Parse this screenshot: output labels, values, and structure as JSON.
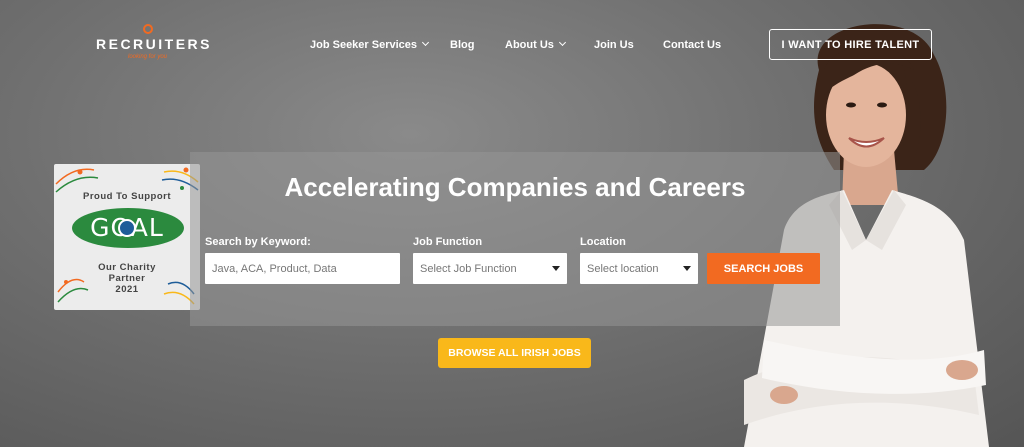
{
  "brand": {
    "name": "RECRUITERS",
    "tagline": "looking for you",
    "accent": "#f26a21"
  },
  "nav": {
    "items": [
      {
        "label": "Job Seeker Services",
        "has_dropdown": true
      },
      {
        "label": "Blog",
        "has_dropdown": false
      },
      {
        "label": "About Us",
        "has_dropdown": true
      },
      {
        "label": "Join Us",
        "has_dropdown": false
      },
      {
        "label": "Contact Us",
        "has_dropdown": false
      }
    ],
    "hire_button": "I WANT TO HIRE TALENT"
  },
  "badge": {
    "top": "Proud To Support",
    "logo_word": "GOAL",
    "line1": "Our Charity",
    "line2": "Partner",
    "year": "2021"
  },
  "hero": {
    "headline": "Accelerating Companies and Careers",
    "keyword": {
      "label": "Search by Keyword:",
      "placeholder": "Java, ACA, Product, Data",
      "value": ""
    },
    "function": {
      "label": "Job Function",
      "selected": "Select Job Function"
    },
    "location": {
      "label": "Location",
      "selected": "Select location"
    },
    "search_button": "SEARCH JOBS",
    "browse_button": "BROWSE ALL IRISH JOBS"
  },
  "colors": {
    "orange": "#f26a21",
    "yellow": "#f9b81a",
    "goal_green": "#2b8a3e"
  },
  "icons": [
    "chevron-down-icon",
    "dropdown-caret-icon",
    "globe-icon",
    "logo-ring-icon"
  ]
}
